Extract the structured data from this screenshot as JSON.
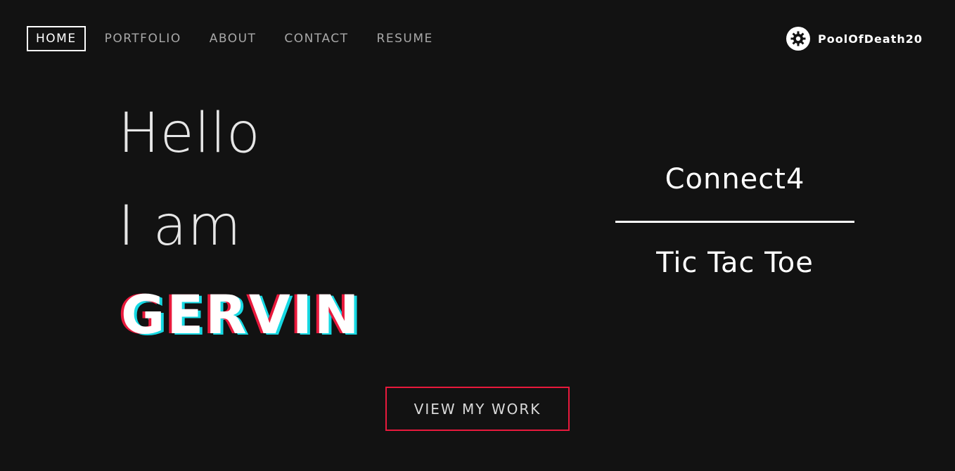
{
  "nav": {
    "items": [
      {
        "label": "HOME",
        "active": true
      },
      {
        "label": "PORTFOLIO",
        "active": false
      },
      {
        "label": "ABOUT",
        "active": false
      },
      {
        "label": "CONTACT",
        "active": false
      },
      {
        "label": "RESUME",
        "active": false
      }
    ]
  },
  "user": {
    "name": "PoolOfDeath20",
    "icon": "gear-icon"
  },
  "hero": {
    "line1": "Hello",
    "line2": "I am",
    "name": "GERVIN"
  },
  "projects": {
    "items": [
      "Connect4",
      "Tic Tac Toe"
    ]
  },
  "cta": {
    "label": "VIEW MY WORK"
  },
  "colors": {
    "background": "#121212",
    "accent_red": "#e8193c",
    "accent_cyan": "#16d9e3",
    "text": "#e6e6e6"
  }
}
